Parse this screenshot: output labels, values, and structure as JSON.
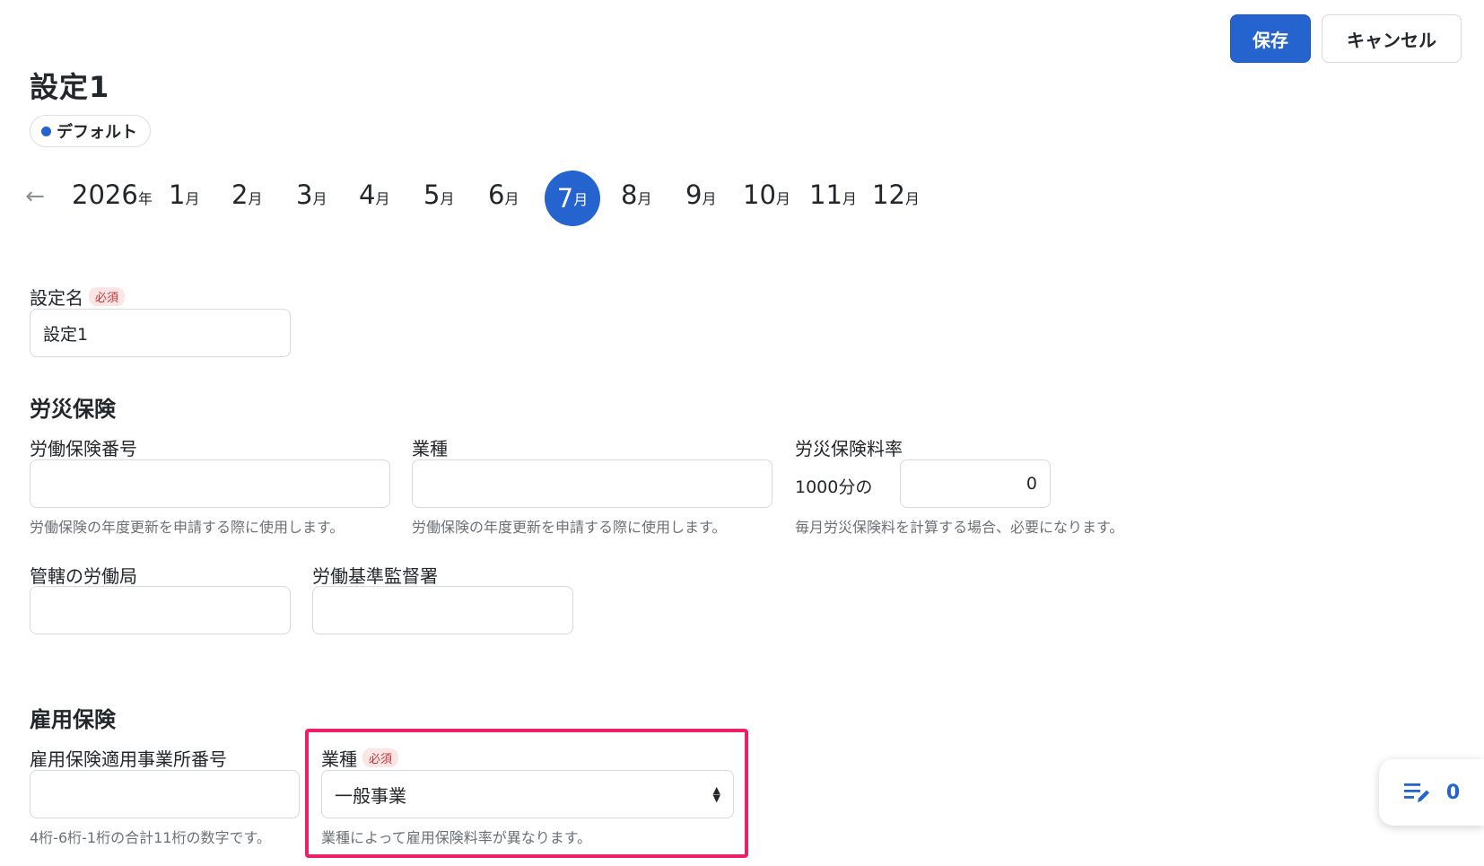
{
  "header": {
    "save_label": "保存",
    "cancel_label": "キャンセル"
  },
  "title": "設定1",
  "default_badge": "デフォルト",
  "calendar": {
    "year": "2026",
    "year_suffix": "年",
    "month_suffix": "月",
    "months": [
      "1",
      "2",
      "3",
      "4",
      "5",
      "6",
      "7",
      "8",
      "9",
      "10",
      "11",
      "12"
    ],
    "selected_month": "7"
  },
  "setting_name": {
    "label": "設定名",
    "required": "必須",
    "value": "設定1"
  },
  "rousai": {
    "heading": "労災保険",
    "number": {
      "label": "労働保険番号",
      "value": "",
      "help": "労働保険の年度更新を申請する際に使用します。"
    },
    "industry": {
      "label": "業種",
      "value": "",
      "help": "労働保険の年度更新を申請する際に使用します。"
    },
    "rate": {
      "label": "労災保険料率",
      "prefix": "1000分の",
      "value": "0",
      "help": "毎月労災保険料を計算する場合、必要になります。"
    },
    "labor_bureau": {
      "label": "管轄の労働局",
      "value": ""
    },
    "inspection_office": {
      "label": "労働基準監督署",
      "value": ""
    }
  },
  "koyou": {
    "heading": "雇用保険",
    "office_number": {
      "label": "雇用保険適用事業所番号",
      "value": "",
      "help": "4桁-6桁-1桁の合計11桁の数字です。"
    },
    "industry": {
      "label": "業種",
      "required": "必須",
      "value": "一般事業",
      "help": "業種によって雇用保険料率が異なります。"
    }
  },
  "memo": {
    "count": "0",
    "icon": "edit-list-icon"
  },
  "colors": {
    "accent": "#2563cf",
    "highlight": "#ee1d66",
    "required": "#c0353b"
  }
}
